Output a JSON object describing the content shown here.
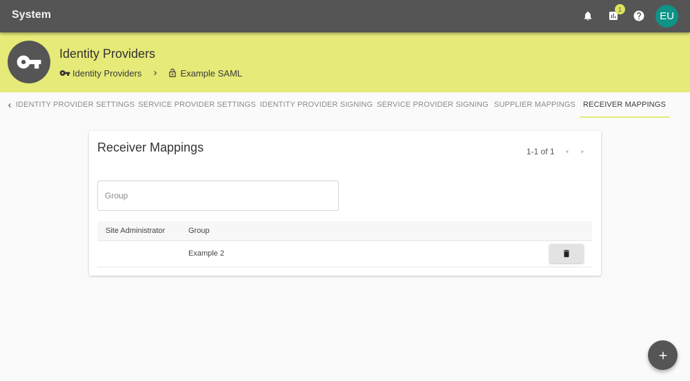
{
  "topbar": {
    "title": "System",
    "notifications_badge": "1",
    "avatar_initials": "EU",
    "icons": [
      "bell-icon",
      "chart-icon",
      "help-icon"
    ]
  },
  "header": {
    "title": "Identity Providers",
    "breadcrumbs": [
      {
        "label": "Identity Providers",
        "icon": "key-icon"
      },
      {
        "label": "Example SAML",
        "icon": "lock-open-icon"
      }
    ]
  },
  "tabs": [
    {
      "label": "IDENTITY PROVIDER SETTINGS",
      "active": false
    },
    {
      "label": "SERVICE PROVIDER SETTINGS",
      "active": false
    },
    {
      "label": "IDENTITY PROVIDER SIGNING",
      "active": false
    },
    {
      "label": "SERVICE PROVIDER SIGNING",
      "active": false
    },
    {
      "label": "SUPPLIER MAPPINGS",
      "active": false
    },
    {
      "label": "RECEIVER MAPPINGS",
      "active": true
    }
  ],
  "card": {
    "title": "Receiver Mappings",
    "pagination": "1-1 of 1",
    "group_input": {
      "placeholder": "Group",
      "value": ""
    },
    "table": {
      "columns": [
        "Site Administrator",
        "Group"
      ],
      "rows": [
        {
          "site_administrator": "",
          "group": "Example 2"
        }
      ]
    }
  },
  "colors": {
    "topbar": "#555555",
    "header": "#e6ea78",
    "avatar": "#0e9386",
    "badge": "#dfe45a"
  }
}
